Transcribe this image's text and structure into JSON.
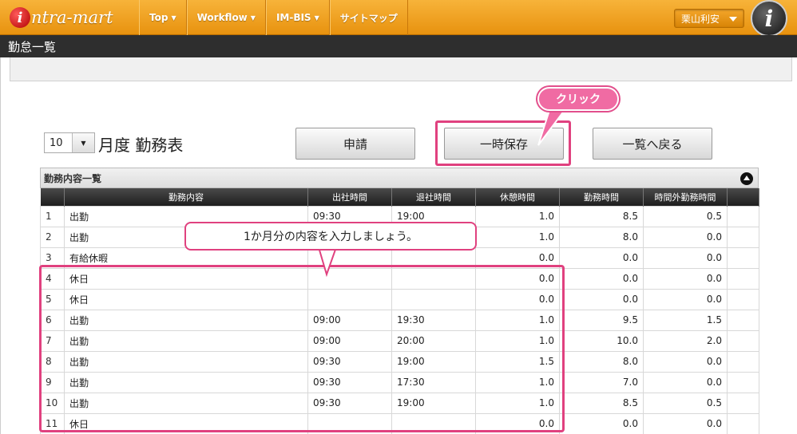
{
  "app": {
    "logo_text": "ntra-mart",
    "logo_letter": "i",
    "info_letter": "i"
  },
  "nav": [
    {
      "label": "Top"
    },
    {
      "label": "Workflow"
    },
    {
      "label": "IM-BIS"
    },
    {
      "label": "サイトマップ"
    }
  ],
  "user": {
    "name": "栗山利安"
  },
  "page": {
    "title": "勤怠一覧"
  },
  "form": {
    "month_value": "10",
    "month_label": "月度 勤務表",
    "apply_label": "申請",
    "save_label": "一時保存",
    "back_label": "一覧へ戻る"
  },
  "panel": {
    "title": "勤務内容一覧"
  },
  "table": {
    "headers": [
      "勤務内容",
      "出社時間",
      "退社時間",
      "休憩時間",
      "勤務時間",
      "時間外勤務時間"
    ],
    "rows": [
      {
        "idx": "1",
        "content": "出勤",
        "in": "09:30",
        "out": "19:00",
        "break": "1.0",
        "work": "8.5",
        "overtime": "0.5"
      },
      {
        "idx": "2",
        "content": "出勤",
        "in": "",
        "out": "",
        "break": "1.0",
        "work": "8.0",
        "overtime": "0.0"
      },
      {
        "idx": "3",
        "content": "有給休暇",
        "in": "",
        "out": "",
        "break": "0.0",
        "work": "0.0",
        "overtime": "0.0"
      },
      {
        "idx": "4",
        "content": "休日",
        "in": "",
        "out": "",
        "break": "0.0",
        "work": "0.0",
        "overtime": "0.0"
      },
      {
        "idx": "5",
        "content": "休日",
        "in": "",
        "out": "",
        "break": "0.0",
        "work": "0.0",
        "overtime": "0.0"
      },
      {
        "idx": "6",
        "content": "出勤",
        "in": "09:00",
        "out": "19:30",
        "break": "1.0",
        "work": "9.5",
        "overtime": "1.5"
      },
      {
        "idx": "7",
        "content": "出勤",
        "in": "09:00",
        "out": "20:00",
        "break": "1.0",
        "work": "10.0",
        "overtime": "2.0"
      },
      {
        "idx": "8",
        "content": "出勤",
        "in": "09:30",
        "out": "19:00",
        "break": "1.5",
        "work": "8.0",
        "overtime": "0.0"
      },
      {
        "idx": "9",
        "content": "出勤",
        "in": "09:30",
        "out": "17:30",
        "break": "1.0",
        "work": "7.0",
        "overtime": "0.0"
      },
      {
        "idx": "10",
        "content": "出勤",
        "in": "09:30",
        "out": "19:00",
        "break": "1.0",
        "work": "8.5",
        "overtime": "0.5"
      },
      {
        "idx": "11",
        "content": "休日",
        "in": "",
        "out": "",
        "break": "0.0",
        "work": "0.0",
        "overtime": "0.0"
      }
    ]
  },
  "callouts": {
    "click": "クリック",
    "note": "1か月分の内容を入力しましょう。"
  },
  "colors": {
    "accent_pink": "#e0417f",
    "nav_orange": "#f0a020"
  }
}
